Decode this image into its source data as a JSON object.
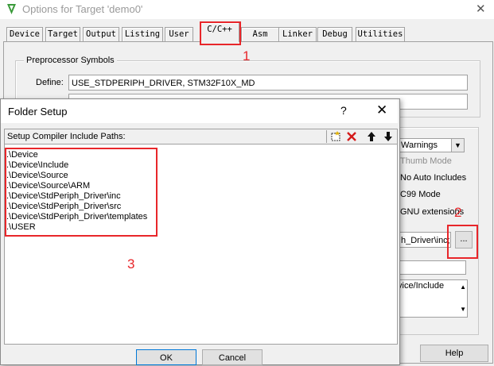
{
  "window": {
    "title": "Options for Target 'demo0'",
    "close_glyph": "✕"
  },
  "tabs": [
    {
      "label": "Device"
    },
    {
      "label": "Target"
    },
    {
      "label": "Output"
    },
    {
      "label": "Listing"
    },
    {
      "label": "User"
    },
    {
      "label": "C/C++",
      "active": true
    },
    {
      "label": "Asm"
    },
    {
      "label": "Linker"
    },
    {
      "label": "Debug"
    },
    {
      "label": "Utilities"
    }
  ],
  "preprocessor": {
    "group_title": "Preprocessor Symbols",
    "define_label": "Define:",
    "define_value": "USE_STDPERIPH_DRIVER, STM32F10X_MD"
  },
  "right_panel": {
    "warnings_value": "Warnings",
    "thumb_mode_label": "Thumb Mode",
    "no_auto_includes_label": "No Auto Includes",
    "c99_label": "C99 Mode",
    "gnu_label": "GNU extensions",
    "include_paths_value": "h_Driver\\inc;",
    "browse_label": "...",
    "misc_text": "vice/Include"
  },
  "help_button": "Help",
  "folder_setup": {
    "title": "Folder Setup",
    "help_glyph": "?",
    "close_glyph": "✕",
    "list_header": "Setup Compiler Include Paths:",
    "paths": [
      ".\\Device",
      ".\\Device\\Include",
      ".\\Device\\Source",
      ".\\Device\\Source\\ARM",
      ".\\Device\\StdPeriph_Driver\\inc",
      ".\\Device\\StdPeriph_Driver\\src",
      ".\\Device\\StdPeriph_Driver\\templates",
      ".\\USER"
    ],
    "ok_label": "OK",
    "cancel_label": "Cancel"
  },
  "annotations": {
    "one": "1",
    "two": "2",
    "three": "3"
  },
  "colors": {
    "annotation": "#e8262a",
    "window_bg": "#f0f0f0",
    "icon_green": "#3a9a3a"
  }
}
